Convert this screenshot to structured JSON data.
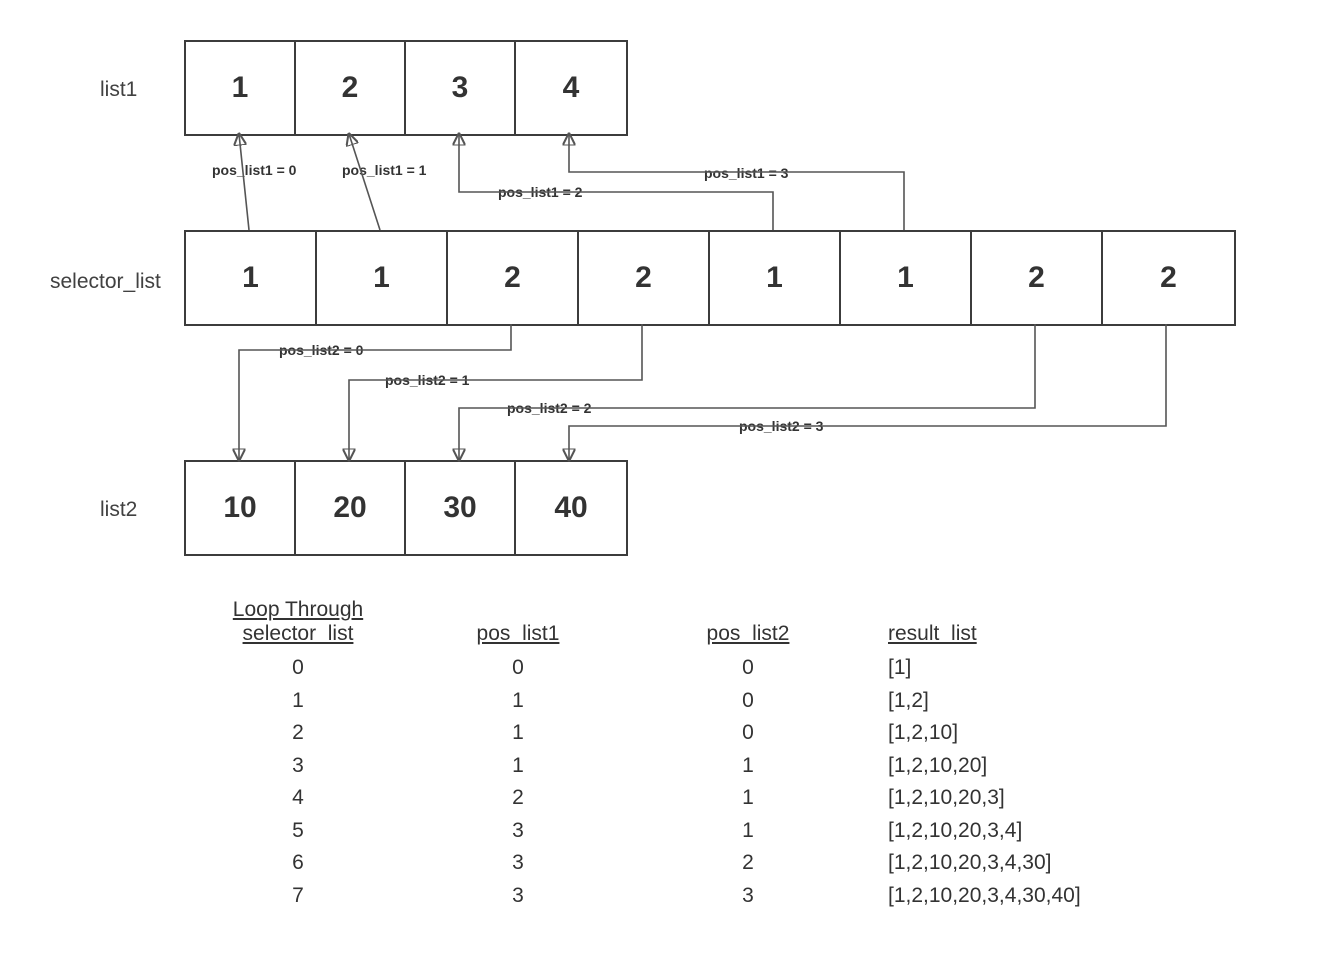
{
  "labels": {
    "list1": "list1",
    "selector_list": "selector_list",
    "list2": "list2"
  },
  "list1": {
    "cells": [
      "1",
      "2",
      "3",
      "4"
    ]
  },
  "selector_list": {
    "cells": [
      "1",
      "1",
      "2",
      "2",
      "1",
      "1",
      "2",
      "2"
    ]
  },
  "list2": {
    "cells": [
      "10",
      "20",
      "30",
      "40"
    ]
  },
  "arrows_up": [
    {
      "label": "pos_list1 = 0"
    },
    {
      "label": "pos_list1 = 1"
    },
    {
      "label": "pos_list1 = 2"
    },
    {
      "label": "pos_list1 = 3"
    }
  ],
  "arrows_down": [
    {
      "label": "pos_list2 = 0"
    },
    {
      "label": "pos_list2 = 1"
    },
    {
      "label": "pos_list2 = 2"
    },
    {
      "label": "pos_list2 = 3"
    }
  ],
  "trace": {
    "headers": {
      "c0_line1": "Loop Through",
      "c0_line2": "selector_list",
      "c1": "pos_list1",
      "c2": "pos_list2",
      "c3": "result_list"
    },
    "rows": [
      {
        "i": "0",
        "p1": "0",
        "p2": "0",
        "res": "[1]"
      },
      {
        "i": "1",
        "p1": "1",
        "p2": "0",
        "res": "[1,2]"
      },
      {
        "i": "2",
        "p1": "1",
        "p2": "0",
        "res": "[1,2,10]"
      },
      {
        "i": "3",
        "p1": "1",
        "p2": "1",
        "res": "[1,2,10,20]"
      },
      {
        "i": "4",
        "p1": "2",
        "p2": "1",
        "res": "[1,2,10,20,3]"
      },
      {
        "i": "5",
        "p1": "3",
        "p2": "1",
        "res": "[1,2,10,20,3,4]"
      },
      {
        "i": "6",
        "p1": "3",
        "p2": "2",
        "res": "[1,2,10,20,3,4,30]"
      },
      {
        "i": "7",
        "p1": "3",
        "p2": "3",
        "res": "[1,2,10,20,3,4,30,40]"
      }
    ]
  }
}
